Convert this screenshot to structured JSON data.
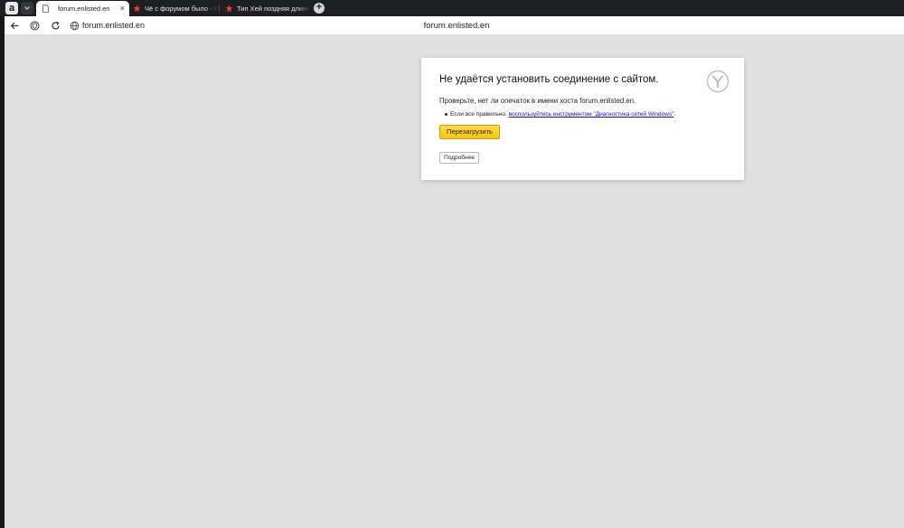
{
  "browser": {
    "app_badge": "a",
    "tabs": [
      {
        "title": "forum.enlisted.en",
        "close": "×"
      },
      {
        "title": "Чё с форумом было - Кон"
      },
      {
        "title": "Тип Хей поздняя длинная"
      }
    ],
    "new_tab": "+"
  },
  "toolbar": {
    "address": "forum.enlisted.en",
    "page_title": "forum.enlisted.en"
  },
  "error": {
    "title": "Не удаётся установить соединение с сайтом.",
    "description": "Проверьте, нет ли опечаток в имени хоста forum.enlisted.en.",
    "hint_text": "Если все правильно, ",
    "hint_link": "воспользуйтесь инструментом \"Диагностика сетей Windows\"",
    "hint_end": ".",
    "reload_label": "Перезагрузить",
    "more_label": "Подробнее"
  },
  "colors": {
    "accent": "#ffdb4d",
    "page_bg": "#e0e0e0",
    "tab_bar_bg": "#1e1f23",
    "tab_favicon": "#e8413a"
  },
  "icons": [
    "back-arrow-icon",
    "shield-icon",
    "reload-icon",
    "globe-icon",
    "document-icon",
    "yandex-logo-icon",
    "chevron-down-icon",
    "plus-icon"
  ]
}
